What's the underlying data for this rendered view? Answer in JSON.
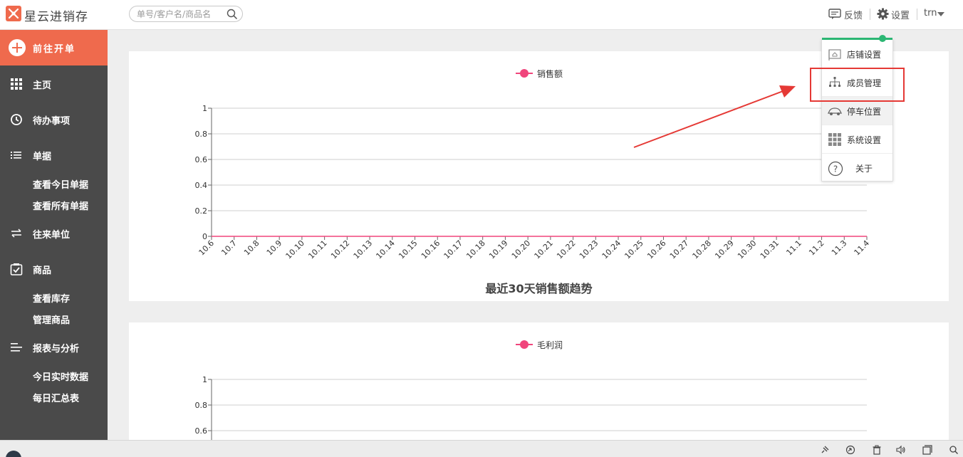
{
  "app": {
    "title": "星云进销存"
  },
  "search": {
    "placeholder": "单号/客户名/商品名"
  },
  "topbar": {
    "feedback": "反馈",
    "settings": "设置",
    "user": "trn"
  },
  "sidebar": {
    "new_order": "前往开单",
    "items": [
      {
        "label": "主页",
        "icon": "grid-icon"
      },
      {
        "label": "待办事项",
        "icon": "clock-icon"
      },
      {
        "label": "单据",
        "icon": "list-icon",
        "children": [
          "查看今日单据",
          "查看所有单据"
        ]
      },
      {
        "label": "往来单位",
        "icon": "exchange-icon"
      },
      {
        "label": "商品",
        "icon": "checkbox-icon",
        "children": [
          "查看库存",
          "管理商品"
        ]
      },
      {
        "label": "报表与分析",
        "icon": "bars-icon",
        "children": [
          "今日实时数据",
          "每日汇总表"
        ]
      }
    ]
  },
  "dropdown": {
    "items": [
      {
        "label": "店铺设置",
        "icon": "store-icon"
      },
      {
        "label": "成员管理",
        "icon": "org-chart-icon"
      },
      {
        "label": "停车位置",
        "icon": "car-icon"
      },
      {
        "label": "系统设置",
        "icon": "grid-icon"
      },
      {
        "label": "关于",
        "icon": "help-icon"
      }
    ]
  },
  "colors": {
    "accent": "#ef6a4d",
    "sidebar": "#4a4a4a",
    "series": "#f0457c",
    "highlight": "#e53935",
    "indicator": "#2bb673"
  },
  "chart_data": [
    {
      "type": "line",
      "title": "最近30天销售额趋势",
      "x": [
        "10.6",
        "10.7",
        "10.8",
        "10.9",
        "10.10",
        "10.11",
        "10.12",
        "10.13",
        "10.14",
        "10.15",
        "10.16",
        "10.17",
        "10.18",
        "10.19",
        "10.20",
        "10.21",
        "10.22",
        "10.23",
        "10.24",
        "10.25",
        "10.26",
        "10.27",
        "10.28",
        "10.29",
        "10.30",
        "10.31",
        "11.1",
        "11.2",
        "11.3",
        "11.4"
      ],
      "series": [
        {
          "name": "销售额",
          "values": [
            0,
            0,
            0,
            0,
            0,
            0,
            0,
            0,
            0,
            0,
            0,
            0,
            0,
            0,
            0,
            0,
            0,
            0,
            0,
            0,
            0,
            0,
            0,
            0,
            0,
            0,
            0,
            0,
            0,
            0
          ]
        }
      ],
      "yticks": [
        "0",
        "0.2",
        "0.4",
        "0.6",
        "0.8",
        "1"
      ],
      "ylim": [
        0,
        1
      ],
      "grid": true,
      "legend": "top-center"
    },
    {
      "type": "line",
      "title": "",
      "series": [
        {
          "name": "毛利润",
          "values": []
        }
      ],
      "yticks": [
        "0.6",
        "0.8",
        "1"
      ],
      "ylim": [
        0,
        1
      ],
      "grid": true,
      "legend": "top-center"
    }
  ]
}
